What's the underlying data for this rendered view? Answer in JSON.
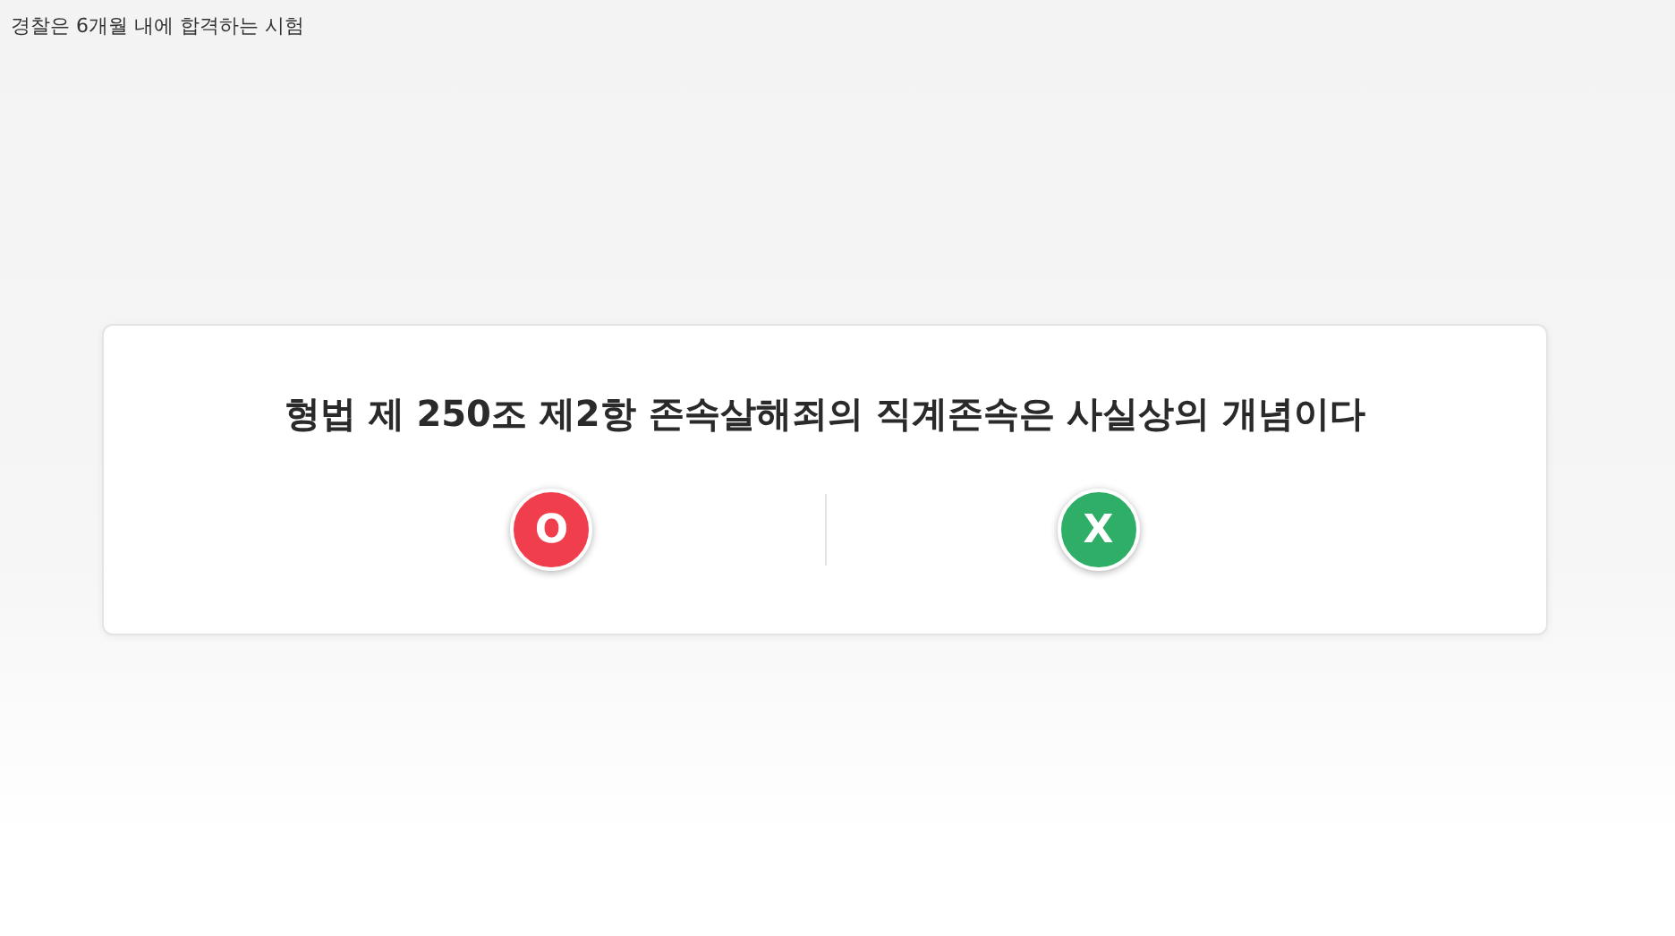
{
  "header": {
    "title": "경찰은 6개월 내에 합격하는 시험"
  },
  "quiz": {
    "question": "형법 제 250조 제2항 존속살해죄의 직계존속은 사실상의 개념이다",
    "answers": [
      {
        "label": "O",
        "color": "#f03e4c"
      },
      {
        "label": "X",
        "color": "#2fae68"
      }
    ]
  }
}
